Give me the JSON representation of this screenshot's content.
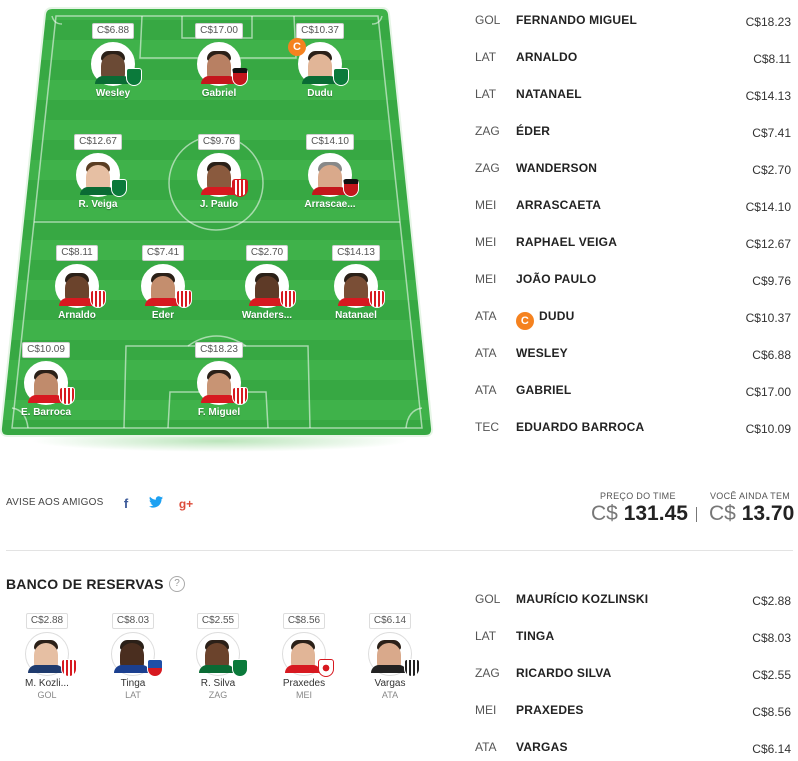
{
  "field": {
    "players": [
      {
        "id": "wesley",
        "price": "C$6.88",
        "name": "Wesley",
        "skin": "#6b4a35",
        "shirt": "#0a6b34",
        "crest": "#0b7a3b"
      },
      {
        "id": "gabriel",
        "price": "C$17.00",
        "name": "Gabriel",
        "skin": "#b88063",
        "shirt": "#c4161c",
        "crest": "#c4161c"
      },
      {
        "id": "dudu",
        "price": "C$10.37",
        "name": "Dudu",
        "skin": "#e1b597",
        "shirt": "#0a6b34",
        "crest": "#0b7a3b",
        "captain": "C"
      },
      {
        "id": "rveiga",
        "price": "C$12.67",
        "name": "R. Veiga",
        "skin": "#e6bfa3",
        "shirt": "#0a6b34",
        "crest": "#0b7a3b"
      },
      {
        "id": "jpaulo",
        "price": "C$9.76",
        "name": "J. Paulo",
        "skin": "#8a5a3e",
        "shirt": "#d71920",
        "crest": "#d71920"
      },
      {
        "id": "arrascaeta",
        "price": "C$14.10",
        "name": "Arrascae...",
        "skin": "#d9a98b",
        "shirt": "#c4161c",
        "crest": "#c4161c"
      },
      {
        "id": "arnaldo",
        "price": "C$8.11",
        "name": "Arnaldo",
        "skin": "#6b432c",
        "shirt": "#d71920",
        "crest": "#d71920"
      },
      {
        "id": "eder",
        "price": "C$7.41",
        "name": "Eder",
        "skin": "#c48e6e",
        "shirt": "#d71920",
        "crest": "#d71920"
      },
      {
        "id": "wanderson",
        "price": "C$2.70",
        "name": "Wanders...",
        "skin": "#5e3a27",
        "shirt": "#d71920",
        "crest": "#d71920"
      },
      {
        "id": "natanael",
        "price": "C$14.13",
        "name": "Natanael",
        "skin": "#7a4e36",
        "shirt": "#d71920",
        "crest": "#d71920"
      },
      {
        "id": "ebarroca",
        "price": "C$10.09",
        "name": "E. Barroca",
        "skin": "#c08b6c",
        "shirt": "#d71920",
        "crest": "#d71920"
      },
      {
        "id": "fmiguel",
        "price": "C$18.23",
        "name": "F. Miguel",
        "skin": "#c89474",
        "shirt": "#d71920",
        "crest": "#d71920"
      }
    ]
  },
  "roster": [
    {
      "pos": "GOL",
      "name": "FERNANDO MIGUEL",
      "price": "C$18.23"
    },
    {
      "pos": "LAT",
      "name": "ARNALDO",
      "price": "C$8.11"
    },
    {
      "pos": "LAT",
      "name": "NATANAEL",
      "price": "C$14.13"
    },
    {
      "pos": "ZAG",
      "name": "ÉDER",
      "price": "C$7.41"
    },
    {
      "pos": "ZAG",
      "name": "WANDERSON",
      "price": "C$2.70"
    },
    {
      "pos": "MEI",
      "name": "ARRASCAETA",
      "price": "C$14.10"
    },
    {
      "pos": "MEI",
      "name": "RAPHAEL VEIGA",
      "price": "C$12.67"
    },
    {
      "pos": "MEI",
      "name": "JOÃO PAULO",
      "price": "C$9.76"
    },
    {
      "pos": "ATA",
      "name": "DUDU",
      "price": "C$10.37",
      "captain": "C"
    },
    {
      "pos": "ATA",
      "name": "WESLEY",
      "price": "C$6.88"
    },
    {
      "pos": "ATA",
      "name": "GABRIEL",
      "price": "C$17.00"
    },
    {
      "pos": "TEC",
      "name": "EDUARDO BARROCA",
      "price": "C$10.09"
    }
  ],
  "share": {
    "label": "AVISE AOS AMIGOS",
    "facebook_icon": "f",
    "twitter_icon": "🐦",
    "googleplus_icon": "g+"
  },
  "totals": {
    "team_price_label": "PREÇO DO TIME",
    "team_price_currency": "C$",
    "team_price_value": "131.45",
    "remaining_label": "VOCÊ AINDA TEM",
    "remaining_currency": "C$",
    "remaining_value": "13.70"
  },
  "bench": {
    "title": "BANCO DE RESERVAS",
    "help_icon": "?",
    "players": [
      {
        "id": "kozlinski",
        "price": "C$2.88",
        "name": "M. Kozli...",
        "pos": "GOL",
        "skin": "#e6bfa3",
        "shirt": "#d71920",
        "crest": "#d71920"
      },
      {
        "id": "tinga",
        "price": "C$8.03",
        "name": "Tinga",
        "pos": "LAT",
        "skin": "#4a2e1f",
        "shirt": "#1b3f8f",
        "crest": "#1f4fa8"
      },
      {
        "id": "rsilva",
        "price": "C$2.55",
        "name": "R. Silva",
        "pos": "ZAG",
        "skin": "#6b432c",
        "shirt": "#0a6b34",
        "crest": "#0b7a3b"
      },
      {
        "id": "praxedes",
        "price": "C$8.56",
        "name": "Praxedes",
        "pos": "MEI",
        "skin": "#e1b597",
        "shirt": "#d71920",
        "crest": "#d71920"
      },
      {
        "id": "vargas",
        "price": "C$6.14",
        "name": "Vargas",
        "pos": "ATA",
        "skin": "#d9a98b",
        "shirt": "#222222",
        "crest": "#222222"
      }
    ]
  },
  "bench_roster": [
    {
      "pos": "GOL",
      "name": "MAURÍCIO KOZLINSKI",
      "price": "C$2.88"
    },
    {
      "pos": "LAT",
      "name": "TINGA",
      "price": "C$8.03"
    },
    {
      "pos": "ZAG",
      "name": "RICARDO SILVA",
      "price": "C$2.55"
    },
    {
      "pos": "MEI",
      "name": "PRAXEDES",
      "price": "C$8.56"
    },
    {
      "pos": "ATA",
      "name": "VARGAS",
      "price": "C$6.14"
    }
  ]
}
